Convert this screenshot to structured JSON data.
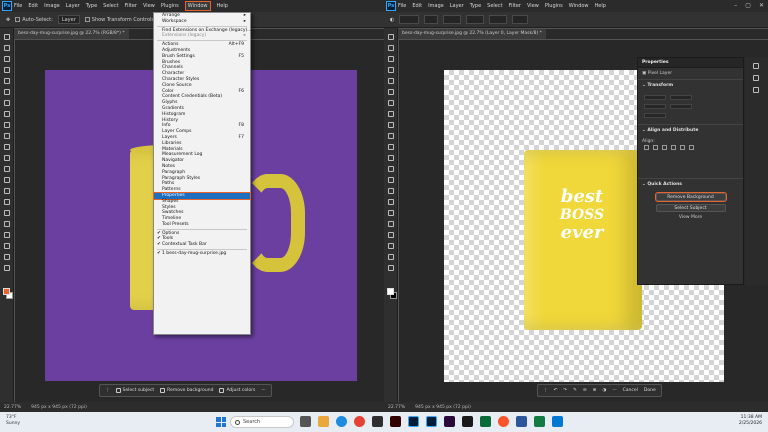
{
  "left_window": {
    "menu": [
      "File",
      "Edit",
      "Image",
      "Layer",
      "Type",
      "Select",
      "Filter",
      "View",
      "Plugins",
      "Window",
      "Help"
    ],
    "active_menu": "Window",
    "options": {
      "auto_select": "Auto-Select:",
      "layer": "Layer",
      "show_transform": "Show Transform Controls"
    },
    "tab": "bess-day-mug-surprise.jpg @ 22.7% (RGB/8*) *",
    "status": "22.77%",
    "status_size": "945 px x 945 px (72 ppi)",
    "context_bar": [
      "Select subject",
      "Remove background",
      "Adjust colors"
    ],
    "dropdown": {
      "top": [
        {
          "label": "Arrange",
          "arrow": true
        },
        {
          "label": "Workspace",
          "arrow": true
        }
      ],
      "ext": [
        {
          "label": "Find Extensions on Exchange (legacy)..."
        },
        {
          "label": "Extensions (legacy)",
          "disabled": true,
          "arrow": true
        }
      ],
      "panels": [
        {
          "label": "Actions",
          "shortcut": "Alt+F9"
        },
        {
          "label": "Adjustments"
        },
        {
          "label": "Brush Settings",
          "shortcut": "F5"
        },
        {
          "label": "Brushes"
        },
        {
          "label": "Channels"
        },
        {
          "label": "Character"
        },
        {
          "label": "Character Styles"
        },
        {
          "label": "Clone Source"
        },
        {
          "label": "Color",
          "shortcut": "F6"
        },
        {
          "label": "Content Credentials (Beta)"
        },
        {
          "label": "Glyphs"
        },
        {
          "label": "Gradients"
        },
        {
          "label": "Histogram"
        },
        {
          "label": "History"
        },
        {
          "label": "Info",
          "shortcut": "F8"
        },
        {
          "label": "Layer Comps"
        },
        {
          "label": "Layers",
          "shortcut": "F7"
        },
        {
          "label": "Libraries"
        },
        {
          "label": "Materials"
        },
        {
          "label": "Measurement Log"
        },
        {
          "label": "Navigator"
        },
        {
          "label": "Notes"
        },
        {
          "label": "Paragraph"
        },
        {
          "label": "Paragraph Styles"
        },
        {
          "label": "Paths"
        },
        {
          "label": "Patterns"
        },
        {
          "label": "Properties",
          "highlight": true
        },
        {
          "label": "Shapes"
        },
        {
          "label": "Styles"
        },
        {
          "label": "Swatches"
        },
        {
          "label": "Timeline"
        },
        {
          "label": "Tool Presets"
        }
      ],
      "checked": [
        {
          "label": "Options"
        },
        {
          "label": "Tools"
        },
        {
          "label": "Contextual Task Bar"
        }
      ],
      "docs": [
        {
          "label": "1 bess-day-mug-surprise.jpg"
        }
      ]
    }
  },
  "right_window": {
    "menu": [
      "File",
      "Edit",
      "Image",
      "Layer",
      "Type",
      "Select",
      "Filter",
      "View",
      "Plugins",
      "Window",
      "Help"
    ],
    "tab": "bess-day-mug-surprise.jpg @ 22.7% (Layer 0, Layer Mask/8) *",
    "status": "22.77%",
    "status_size": "945 px x 945 px (72 ppi)",
    "mug_text": [
      "best",
      "BOSS",
      "ever"
    ],
    "context_bar": [
      "Cancel",
      "Done"
    ],
    "panel": {
      "title": "Properties",
      "layer_type": "Pixel Layer",
      "sections": {
        "transform": "Transform",
        "align": "Align and Distribute",
        "quick": "Quick Actions"
      },
      "align_label": "Align:",
      "buttons": [
        "Remove Background",
        "Select Subject",
        "View More"
      ]
    }
  },
  "taskbar": {
    "weather_temp": "73°F",
    "weather_desc": "Sunny",
    "search_placeholder": "Search",
    "time": "11:38 AM",
    "date": "2/25/2026"
  },
  "colors": {
    "accent_highlight": "#e8642c",
    "menu_highlight": "#1f6fc1",
    "purple_bg": "#6b3fa0",
    "mug_yellow": "#f0d83a"
  }
}
